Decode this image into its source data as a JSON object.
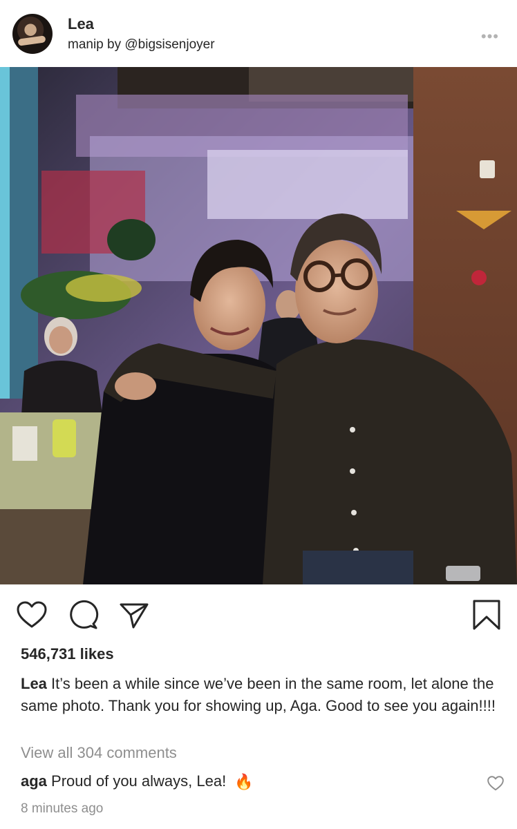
{
  "post": {
    "username": "Lea",
    "subtitle": "manip by @bigsisenjoyer",
    "more_icon": "more-horizontal-icon",
    "photo_alt": "",
    "likes": "546,731 likes",
    "caption_user": "Lea",
    "caption_text": "It’s been a while since we’ve been in the same room, let alone the same photo. Thank you for showing up, Aga. Good to see you again!!!!",
    "view_all": "View all 304 comments",
    "comment_user": "aga",
    "comment_text": "Proud of you always, Lea!",
    "comment_emoji": "🔥",
    "timestamp": "8 minutes ago"
  },
  "icons": {
    "like": "heart-icon",
    "comment": "comment-icon",
    "share": "send-icon",
    "save": "bookmark-icon"
  },
  "colors": {
    "text": "#262626",
    "muted": "#8e8e8e",
    "icon_muted": "#b3b3b3"
  }
}
